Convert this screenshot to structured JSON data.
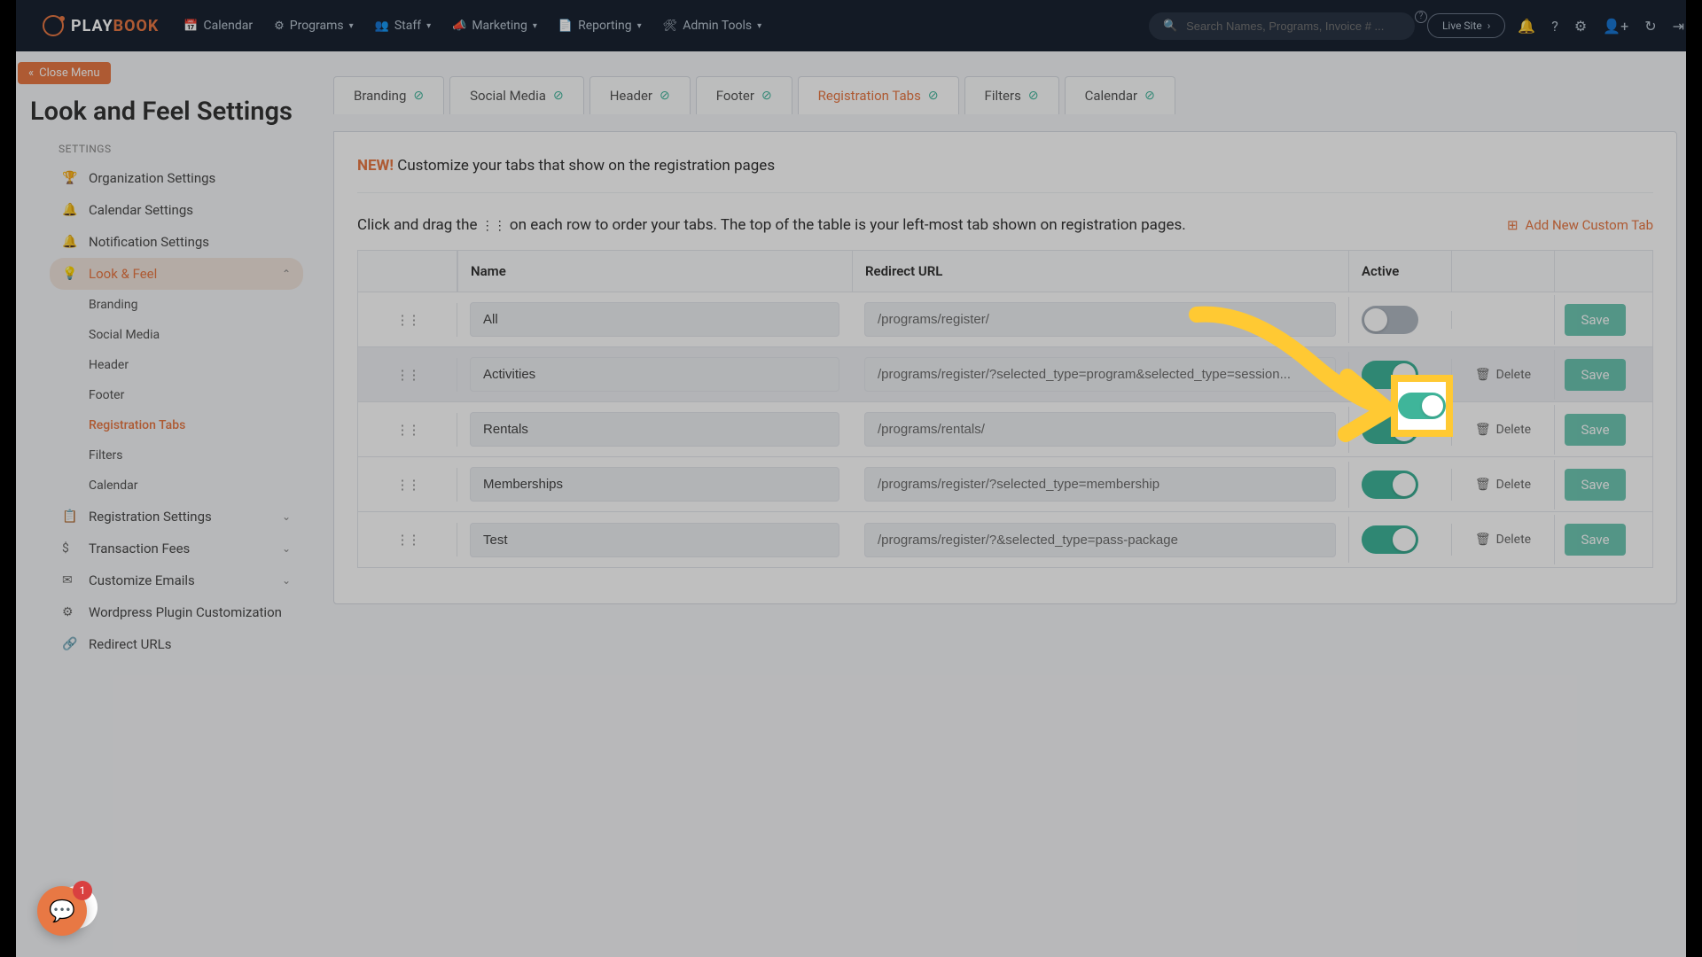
{
  "nav": {
    "logo_play": "PLAY",
    "logo_book": "BOOK",
    "items": [
      {
        "label": "Calendar",
        "icon": "📅",
        "dropdown": false
      },
      {
        "label": "Programs",
        "icon": "⚙",
        "dropdown": true
      },
      {
        "label": "Staff",
        "icon": "👥",
        "dropdown": true
      },
      {
        "label": "Marketing",
        "icon": "📣",
        "dropdown": true
      },
      {
        "label": "Reporting",
        "icon": "📄",
        "dropdown": true
      },
      {
        "label": "Admin Tools",
        "icon": "🛠",
        "dropdown": true
      }
    ],
    "search_placeholder": "Search Names, Programs, Invoice # ...",
    "live_site": "Live Site"
  },
  "sidebar": {
    "close_label": "Close Menu",
    "page_title": "Look and Feel Settings",
    "section_label": "SETTINGS",
    "items": [
      {
        "label": "Organization Settings",
        "icon": "🏆"
      },
      {
        "label": "Calendar Settings",
        "icon": "🔔"
      },
      {
        "label": "Notification Settings",
        "icon": "🔔"
      },
      {
        "label": "Look & Feel",
        "icon": "💡",
        "active": true
      },
      {
        "label": "Branding",
        "sub": true
      },
      {
        "label": "Social Media",
        "sub": true
      },
      {
        "label": "Header",
        "sub": true
      },
      {
        "label": "Footer",
        "sub": true
      },
      {
        "label": "Registration Tabs",
        "sub": true,
        "active_sub": true
      },
      {
        "label": "Filters",
        "sub": true
      },
      {
        "label": "Calendar",
        "sub": true
      },
      {
        "label": "Registration Settings",
        "icon": "📋",
        "chev": true
      },
      {
        "label": "Transaction Fees",
        "icon": "$",
        "chev": true
      },
      {
        "label": "Customize Emails",
        "icon": "✉",
        "chev": true
      },
      {
        "label": "Wordpress Plugin Customization",
        "icon": "⚙"
      },
      {
        "label": "Redirect URLs",
        "icon": "🔗"
      }
    ]
  },
  "tabs": [
    {
      "label": "Branding"
    },
    {
      "label": "Social Media"
    },
    {
      "label": "Header"
    },
    {
      "label": "Footer"
    },
    {
      "label": "Registration Tabs",
      "active": true
    },
    {
      "label": "Filters"
    },
    {
      "label": "Calendar"
    }
  ],
  "panel": {
    "new_label": "NEW!",
    "notice": "Customize your tabs that show on the registration pages",
    "instr_pre": "Click and drag the ",
    "instr_post": " on each row to order your tabs. The top of the table is your left-most tab shown on registration pages.",
    "add_btn": "Add New Custom Tab"
  },
  "table": {
    "headers": {
      "name": "Name",
      "url": "Redirect URL",
      "active": "Active"
    },
    "delete_label": "Delete",
    "save_label": "Save",
    "rows": [
      {
        "name": "All",
        "url": "/programs/register/",
        "active": false,
        "deletable": false
      },
      {
        "name": "Activities",
        "url": "/programs/register/?selected_type=program&selected_type=session...",
        "active": true,
        "deletable": true,
        "highlighted": true
      },
      {
        "name": "Rentals",
        "url": "/programs/rentals/",
        "active": true,
        "deletable": true
      },
      {
        "name": "Memberships",
        "url": "/programs/register/?selected_type=membership",
        "active": true,
        "deletable": true
      },
      {
        "name": "Test",
        "url": "/programs/register/?&selected_type=pass-package",
        "active": true,
        "deletable": true
      }
    ]
  },
  "chat_badge": "1"
}
